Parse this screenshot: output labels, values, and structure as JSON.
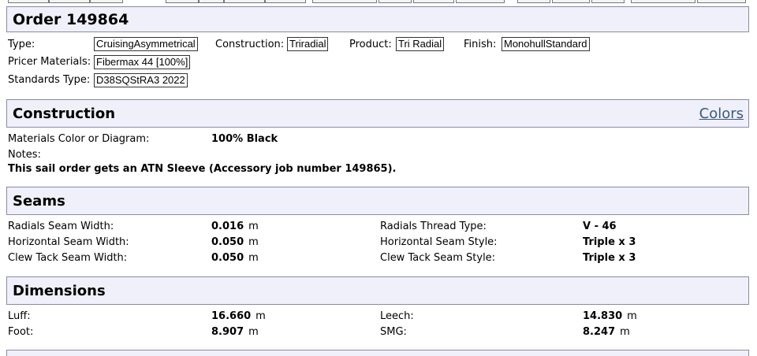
{
  "order": {
    "title": "Order 149864"
  },
  "fields": {
    "type_label": "Type:",
    "type_value": "CruisingAsymmetrical",
    "construction_label": "Construction:",
    "construction_value": "Triradial",
    "product_label": "Product:",
    "product_value": "Tri Radial",
    "finish_label": "Finish:",
    "finish_value": "MonohullStandard",
    "pricer_label": "Pricer Materials:",
    "pricer_value": "Fibermax 44 [100%]",
    "standards_label": "Standards Type:",
    "standards_value": "D38SQStRA3 2022"
  },
  "construction": {
    "title": "Construction",
    "colors_link": "Colors",
    "materials_label": "Materials Color or Diagram:",
    "materials_value": "100% Black",
    "notes_label": "Notes:",
    "notes_text": "This sail order gets an ATN Sleeve (Accessory job number 149865)."
  },
  "seams": {
    "title": "Seams",
    "rows": [
      {
        "label": "Radials Seam Width:",
        "value": "0.016",
        "unit": "m",
        "label2": "Radials Thread Type:",
        "value2": "V - 46"
      },
      {
        "label": "Horizontal Seam Width:",
        "value": "0.050",
        "unit": "m",
        "label2": "Horizontal Seam Style:",
        "value2": "Triple x 3"
      },
      {
        "label": "Clew Tack Seam Width:",
        "value": "0.050",
        "unit": "m",
        "label2": "Clew Tack Seam Style:",
        "value2": "Triple x 3"
      }
    ]
  },
  "dimensions": {
    "title": "Dimensions",
    "rows": [
      {
        "label": "Luff:",
        "value": "16.660",
        "unit": "m",
        "label2": "Leech:",
        "value2": "14.830",
        "unit2": "m"
      },
      {
        "label": "Foot:",
        "value": "8.907",
        "unit": "m",
        "label2": "SMG:",
        "value2": "8.247",
        "unit2": "m"
      }
    ]
  }
}
